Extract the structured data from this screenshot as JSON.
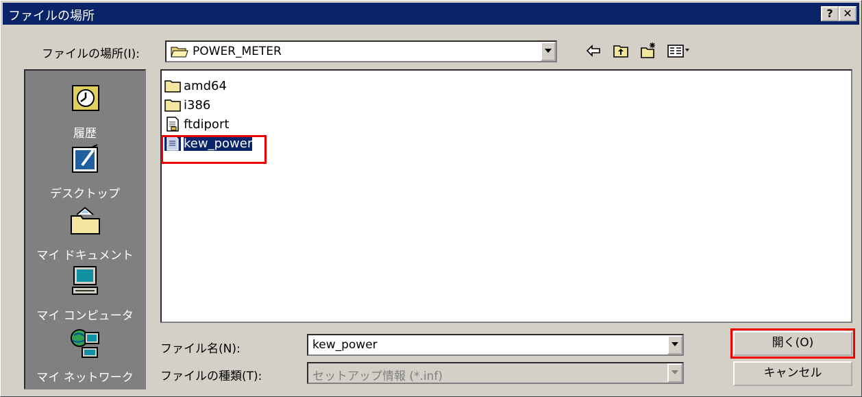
{
  "window": {
    "title": "ファイルの場所",
    "help_label": "?",
    "close_label": "✕"
  },
  "location": {
    "label": "ファイルの場所(I):",
    "value": "POWER_METER"
  },
  "toolbar": {
    "back_icon": "back-arrow-icon",
    "up_icon": "up-folder-icon",
    "new_folder_icon": "new-folder-icon",
    "view_icon": "view-menu-icon"
  },
  "places": [
    {
      "label": "履歴",
      "icon": "history-icon"
    },
    {
      "label": "デスクトップ",
      "icon": "desktop-icon"
    },
    {
      "label": "マイ ドキュメント",
      "icon": "my-documents-icon"
    },
    {
      "label": "マイ コンピュータ",
      "icon": "my-computer-icon"
    },
    {
      "label": "マイ ネットワーク",
      "icon": "my-network-icon"
    }
  ],
  "files": [
    {
      "name": "amd64",
      "type": "folder"
    },
    {
      "name": "i386",
      "type": "folder"
    },
    {
      "name": "ftdiport",
      "type": "inf"
    },
    {
      "name": "kew_power",
      "type": "inf",
      "selected": true
    }
  ],
  "filename": {
    "label": "ファイル名(N):",
    "value": "kew_power"
  },
  "filetype": {
    "label": "ファイルの種類(T):",
    "value": "セットアップ情報 (*.inf)"
  },
  "buttons": {
    "open": "開く(O)",
    "cancel": "キャンセル"
  },
  "colors": {
    "titlebar": "#0a246a",
    "highlight": "#e00000",
    "face": "#d4d0c8"
  }
}
